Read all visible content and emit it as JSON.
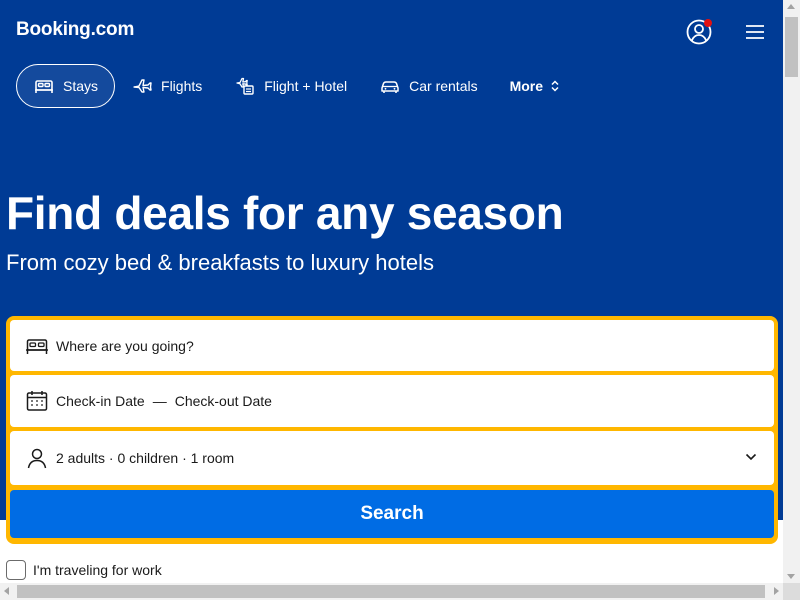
{
  "brand": {
    "logo_text": "Booking.com"
  },
  "header": {
    "account_icon": "account-icon",
    "menu_icon": "hamburger-menu-icon"
  },
  "nav": {
    "items": [
      {
        "label": "Stays",
        "icon": "bed-icon",
        "active": true
      },
      {
        "label": "Flights",
        "icon": "airplane-icon",
        "active": false
      },
      {
        "label": "Flight + Hotel",
        "icon": "flight-hotel-icon",
        "active": false
      },
      {
        "label": "Car rentals",
        "icon": "car-icon",
        "active": false
      },
      {
        "label": "More",
        "icon": "chevron-updown-icon",
        "active": false
      }
    ]
  },
  "hero": {
    "title": "Find deals for any season",
    "subtitle": "From cozy bed & breakfasts to luxury hotels"
  },
  "search": {
    "destination_placeholder": "Where are you going?",
    "checkin_label": "Check-in Date",
    "date_separator": "—",
    "checkout_label": "Check-out Date",
    "guests_summary": "2 adults · 0 children · 1 room",
    "button_label": "Search"
  },
  "options": {
    "work_travel_label": "I'm traveling for work",
    "work_travel_checked": false
  },
  "colors": {
    "header_bg": "#003b95",
    "search_border": "#ffb700",
    "search_button": "#006ce4",
    "notification_dot": "#e21111"
  }
}
